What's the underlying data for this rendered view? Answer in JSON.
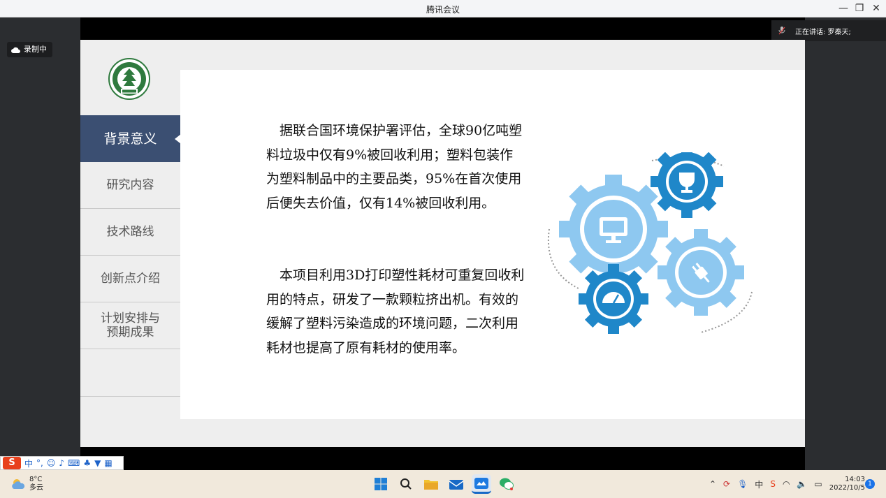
{
  "window": {
    "title": "腾讯会议"
  },
  "meeting": {
    "recording_label": "录制中",
    "speaker_label": "正在讲话: 罗秦天;"
  },
  "slide": {
    "nav": [
      {
        "label": "背景意义",
        "active": true
      },
      {
        "label": "研究内容"
      },
      {
        "label": "技术路线"
      },
      {
        "label": "创新点介绍"
      },
      {
        "label": "计划安排与\n预期成果"
      }
    ],
    "paragraph1": "据联合国环境保护署评估，全球90亿吨塑料垃圾中仅有9%被回收利用；塑料包装作为塑料制品中的主要品类，95%在首次使用后便失去价值，仅有14%被回收利用。",
    "paragraph2": "本项目利用3D打印塑性耗材可重复回收利用的特点，研发了一款颗粒挤出机。有效的缓解了塑料污染造成的环境问题，二次利用耗材也提高了原有耗材的使用率。",
    "colors": {
      "nav_active": "#3b4f72",
      "gear_light": "#8ec8f0",
      "gear_dark": "#1f87c9"
    }
  },
  "ime": {
    "mode": "中"
  },
  "taskbar": {
    "weather_temp": "8°C",
    "weather_desc": "多云",
    "time": "14:03",
    "date": "2022/10/5",
    "notification_count": "1"
  }
}
